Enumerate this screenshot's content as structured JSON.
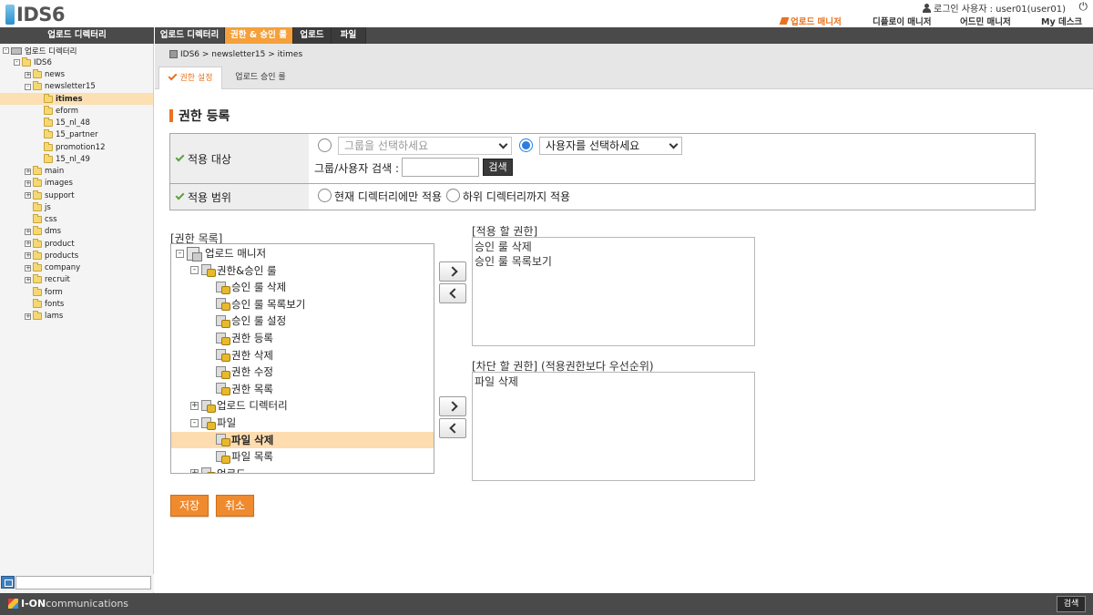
{
  "header": {
    "logo": "IDS6",
    "login_info": "로그인 사용자 : user01(user01)",
    "nav": [
      {
        "label": "업로드 매니저",
        "active": true
      },
      {
        "label": "디플로이 매니저",
        "active": false
      },
      {
        "label": "어드민 매니저",
        "active": false
      },
      {
        "label": "My 데스크",
        "active": false
      }
    ]
  },
  "left": {
    "title": "업로드 디렉터리",
    "tree": [
      {
        "label": "업로드 디렉터리",
        "depth": 0,
        "expand": "-",
        "kind": "drive"
      },
      {
        "label": "IDS6",
        "depth": 1,
        "expand": "-",
        "kind": "folder"
      },
      {
        "label": "news",
        "depth": 2,
        "expand": "+",
        "kind": "folder"
      },
      {
        "label": "newsletter15",
        "depth": 2,
        "expand": "-",
        "kind": "folder"
      },
      {
        "label": "itimes",
        "depth": 3,
        "expand": "",
        "kind": "folder",
        "selected": true
      },
      {
        "label": "eform",
        "depth": 3,
        "expand": "",
        "kind": "folder"
      },
      {
        "label": "15_nl_48",
        "depth": 3,
        "expand": "",
        "kind": "folder"
      },
      {
        "label": "15_partner",
        "depth": 3,
        "expand": "",
        "kind": "folder"
      },
      {
        "label": "promotion12",
        "depth": 3,
        "expand": "",
        "kind": "folder"
      },
      {
        "label": "15_nl_49",
        "depth": 3,
        "expand": "",
        "kind": "folder"
      },
      {
        "label": "main",
        "depth": 2,
        "expand": "+",
        "kind": "folder"
      },
      {
        "label": "images",
        "depth": 2,
        "expand": "+",
        "kind": "folder"
      },
      {
        "label": "support",
        "depth": 2,
        "expand": "+",
        "kind": "folder"
      },
      {
        "label": "js",
        "depth": 2,
        "expand": "",
        "kind": "folder"
      },
      {
        "label": "css",
        "depth": 2,
        "expand": "",
        "kind": "folder"
      },
      {
        "label": "dms",
        "depth": 2,
        "expand": "+",
        "kind": "folder"
      },
      {
        "label": "product",
        "depth": 2,
        "expand": "+",
        "kind": "folder"
      },
      {
        "label": "products",
        "depth": 2,
        "expand": "+",
        "kind": "folder"
      },
      {
        "label": "company",
        "depth": 2,
        "expand": "+",
        "kind": "folder"
      },
      {
        "label": "recruit",
        "depth": 2,
        "expand": "+",
        "kind": "folder"
      },
      {
        "label": "form",
        "depth": 2,
        "expand": "",
        "kind": "folder"
      },
      {
        "label": "fonts",
        "depth": 2,
        "expand": "",
        "kind": "folder"
      },
      {
        "label": "lams",
        "depth": 2,
        "expand": "+",
        "kind": "folder"
      }
    ]
  },
  "main_tabs": [
    {
      "label": "업로드 디렉터리",
      "active": false
    },
    {
      "label": "권한 & 승인 룰",
      "active": true
    },
    {
      "label": "업로드",
      "active": false
    },
    {
      "label": "파일",
      "active": false
    }
  ],
  "breadcrumb": "IDS6 > newsletter15 > itimes",
  "sub_tabs": [
    {
      "label": "권한 설정",
      "active": true
    },
    {
      "label": "업로드 승인 룰",
      "active": false
    }
  ],
  "section_title": "권한 등록",
  "form": {
    "target_label": "적용 대상",
    "group_placeholder": "그룹을 선택하세요",
    "user_placeholder": "사용자를 선택하세요",
    "search_label": "그룹/사용자 검색 :",
    "search_value": "",
    "search_button": "검색",
    "scope_label": "적용 범위",
    "scope_current": "현재 디렉터리에만 적용",
    "scope_sub": "하위 디렉터리까지 적용"
  },
  "perm_list": {
    "label": "[권한 목록]",
    "rows": [
      {
        "label": "업로드 매니저",
        "depth": 0,
        "expand": "-",
        "kind": "root"
      },
      {
        "label": "권한&승인 룰",
        "depth": 1,
        "expand": "-",
        "kind": "key"
      },
      {
        "label": "승인 룰 삭제",
        "depth": 2,
        "expand": "",
        "kind": "key"
      },
      {
        "label": "승인 룰 목록보기",
        "depth": 2,
        "expand": "",
        "kind": "key"
      },
      {
        "label": "승인 룰 설정",
        "depth": 2,
        "expand": "",
        "kind": "key"
      },
      {
        "label": "권한 등록",
        "depth": 2,
        "expand": "",
        "kind": "key"
      },
      {
        "label": "권한 삭제",
        "depth": 2,
        "expand": "",
        "kind": "key"
      },
      {
        "label": "권한 수정",
        "depth": 2,
        "expand": "",
        "kind": "key"
      },
      {
        "label": "권한 목록",
        "depth": 2,
        "expand": "",
        "kind": "key"
      },
      {
        "label": "업로드 디렉터리",
        "depth": 1,
        "expand": "+",
        "kind": "key"
      },
      {
        "label": "파일",
        "depth": 1,
        "expand": "-",
        "kind": "key"
      },
      {
        "label": "파일 삭제",
        "depth": 2,
        "expand": "",
        "kind": "key",
        "selected": true
      },
      {
        "label": "파일 목록",
        "depth": 2,
        "expand": "",
        "kind": "key"
      },
      {
        "label": "업로드",
        "depth": 1,
        "expand": "+",
        "kind": "key"
      }
    ]
  },
  "apply_perms": {
    "label": "[적용 할 권한]",
    "items": [
      "승인 룰 삭제",
      "승인 룰 목록보기"
    ]
  },
  "block_perms": {
    "label": "[차단 할 권한] (적용권한보다 우선순위)",
    "items": [
      "파일 삭제"
    ]
  },
  "buttons": {
    "save": "저장",
    "cancel": "취소"
  },
  "footer": {
    "brand": "I-ON",
    "rest": " communications",
    "search_button": "검색"
  },
  "colors": {
    "accent": "#f5a03a",
    "dark_bar": "#4a4a4a",
    "check_green": "#5aa23a"
  }
}
